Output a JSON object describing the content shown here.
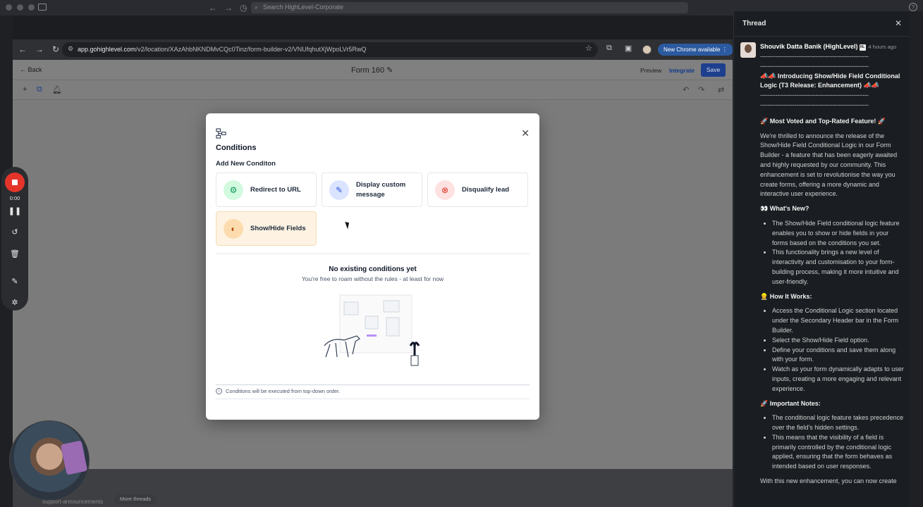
{
  "os": {
    "search_placeholder": "Search HighLevel-Corporate",
    "help": "?"
  },
  "browser": {
    "url_host": "app.gohighlevel.com",
    "url_path": "/v2/location/XAzAhbNKNDMvCQc0Tinz/form-builder-v2/VNUfqhutXjWpoLVr5RwQ",
    "new_chrome": "New Chrome available"
  },
  "app": {
    "back": "Back",
    "form_title": "Form 160",
    "preview": "Preview",
    "integrate": "Integrate",
    "save": "Save"
  },
  "modal": {
    "title": "Conditions",
    "subtitle": "Add New Conditon",
    "options": [
      {
        "label": "Redirect to URL",
        "icon": "brain-icon",
        "color": "#d1fadf"
      },
      {
        "label": "Display custom message",
        "icon": "edit-icon",
        "color": "#dbe4ff"
      },
      {
        "label": "Disqualify lead",
        "icon": "user-x-icon",
        "color": "#fde2e1"
      },
      {
        "label": "Show/Hide Fields",
        "icon": "eye-half-icon",
        "color": "#fcdcae"
      }
    ],
    "empty_title": "No existing conditions yet",
    "empty_subtitle": "You're free to roam without the rules - at least for now",
    "footer_note": "Conditions will be executed from top-down order."
  },
  "recorder": {
    "time": "0:00"
  },
  "slack_bottom": {
    "channel": "support-announcements",
    "more_threads": "More threads"
  },
  "thread": {
    "title": "Thread",
    "author": "Shouvik Datta Banik (HighLevel)",
    "time": "4 hours ago",
    "dashes": "---------------------------------------------------------",
    "headline": "📣📣 Introducing Show/Hide Field Conditional Logic (T3 Release: Enhancement) 📣📣",
    "section1_title": "🚀 Most Voted and Top-Rated Feature! 🚀",
    "section1_body": "We're thrilled to announce the release of the Show/Hide Field Conditional Logic in our Form Builder - a feature that has been eagerly awaited and highly requested by our community. This enhancement is set to revolutionise the way you create forms, offering a more dynamic and interactive user experience.",
    "section2_title": "👀 What's New?",
    "section2_items": [
      "The Show/Hide Field conditional logic feature enables you to show or hide fields in your forms based on the conditions you set.",
      "This functionality brings a new level of interactivity and customisation to your form-building process, making it more intuitive and user-friendly."
    ],
    "section3_title": "👷 How It Works:",
    "section3_items": [
      "Access the Conditional Logic section located under the Secondary Header bar in the Form Builder.",
      "Select the Show/Hide Field option.",
      "Define your conditions and save them along with your form.",
      "Watch as your form dynamically adapts to user inputs, creating a more engaging and relevant experience."
    ],
    "section4_title": "🚀 Important Notes:",
    "section4_items": [
      "The conditional logic feature takes precedence over the field's hidden settings.",
      "This means that the visibility of a field is primarily controlled by the conditional logic applied, ensuring that the form behaves as intended based on user responses."
    ],
    "trailing": "With this new enhancement, you can now create"
  }
}
